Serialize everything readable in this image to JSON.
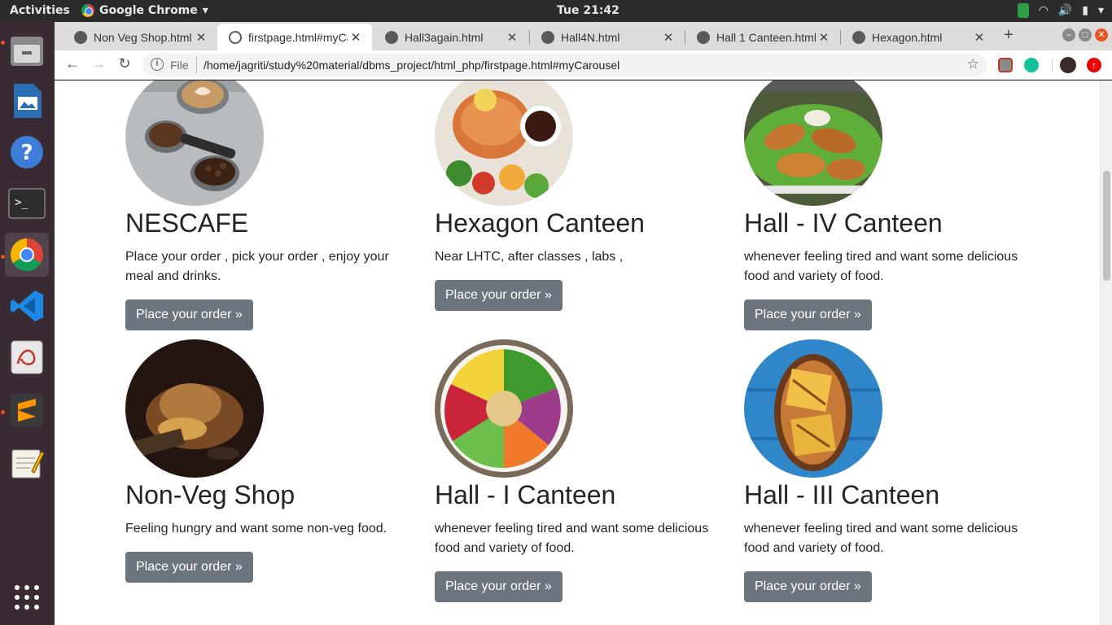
{
  "topbar": {
    "activities": "Activities",
    "app_name": "Google Chrome",
    "clock": "Tue 21:42"
  },
  "dock": {
    "items": [
      {
        "name": "files-icon",
        "color": "#8a8a8a"
      },
      {
        "name": "writer-icon",
        "color": "#2a6fb5"
      },
      {
        "name": "help-icon",
        "color": "#3b7dd8"
      },
      {
        "name": "terminal-icon",
        "color": "#2d2d2d"
      },
      {
        "name": "chrome-icon",
        "color": "#4285f4"
      },
      {
        "name": "vscode-icon",
        "color": "#1e88e5"
      },
      {
        "name": "document-viewer-icon",
        "color": "#d8d8d8"
      },
      {
        "name": "sublime-icon",
        "color": "#3a3a3a"
      },
      {
        "name": "text-editor-icon",
        "color": "#e8e4d8"
      },
      {
        "name": "app-grid-icon",
        "color": "#ffffff"
      }
    ]
  },
  "browser": {
    "tabs": [
      {
        "label": "Non Veg Shop.html",
        "active": false
      },
      {
        "label": "firstpage.html#myCarousel",
        "active": true
      },
      {
        "label": "Hall3again.html",
        "active": false
      },
      {
        "label": "Hall4N.html",
        "active": false
      },
      {
        "label": "Hall 1 Canteen.html",
        "active": false
      },
      {
        "label": "Hexagon.html",
        "active": false
      }
    ],
    "omnibox": {
      "scheme_label": "File",
      "url": "/home/jagriti/study%20material/dbms_project/html_php/firstpage.html#myCarousel"
    }
  },
  "page": {
    "cards": [
      {
        "title": "NESCAFE",
        "text": "Place your order , pick your order , enjoy your meal and drinks.",
        "button": "Place your order »",
        "image": "coffee-photo"
      },
      {
        "title": "Hexagon Canteen",
        "text": "Near LHTC, after classes , labs ,",
        "button": "Place your order »",
        "image": "grilled-fish-photo"
      },
      {
        "title": "Hall - IV Canteen",
        "text": "whenever feeling tired and want some delicious food and variety of food.",
        "button": "Place your order »",
        "image": "fried-chicken-photo"
      },
      {
        "title": "Non-Veg Shop",
        "text": "Feeling hungry and want some non-veg food.",
        "button": "Place your order »",
        "image": "nonveg-dish-photo"
      },
      {
        "title": "Hall - I Canteen",
        "text": "whenever feeling tired and want some delicious food and variety of food.",
        "button": "Place your order »",
        "image": "salad-bowl-photo"
      },
      {
        "title": "Hall - III Canteen",
        "text": "whenever feeling tired and want some delicious food and variety of food.",
        "button": "Place your order »",
        "image": "sandwich-photo"
      }
    ]
  }
}
